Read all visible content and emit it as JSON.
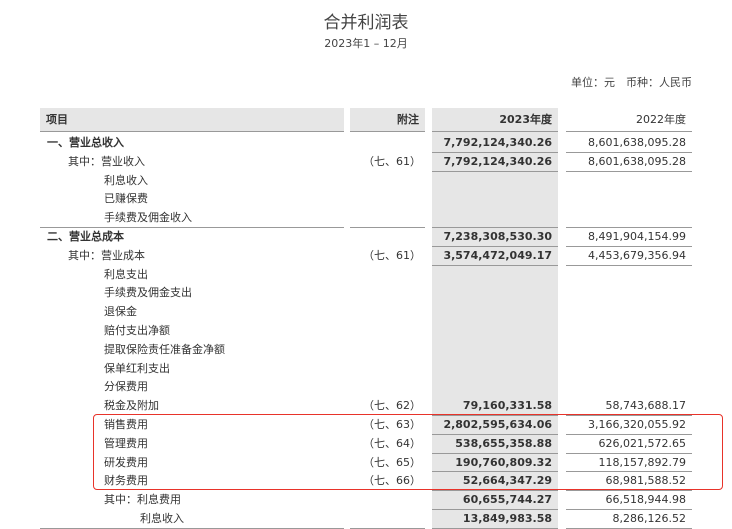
{
  "title": "合并利润表",
  "period": "2023年1 – 12月",
  "unit": "单位：元　币种：人民币",
  "headers": {
    "item": "项目",
    "note": "附注",
    "y2023": "2023年度",
    "y2022": "2022年度"
  },
  "highlight_color": "#e8332a",
  "rows": [
    {
      "label": "一、营业总收入",
      "level": 0,
      "bold": true,
      "note": "",
      "v2023": "7,792,124,340.26",
      "v2022": "8,601,638,095.28"
    },
    {
      "label": "其中：营业收入",
      "level": 1,
      "note": "（七、61）",
      "v2023": "7,792,124,340.26",
      "v2022": "8,601,638,095.28"
    },
    {
      "label": "利息收入",
      "level": 2,
      "note": "",
      "v2023": "",
      "v2022": ""
    },
    {
      "label": "已赚保费",
      "level": 2,
      "note": "",
      "v2023": "",
      "v2022": ""
    },
    {
      "label": "手续费及佣金收入",
      "level": 2,
      "note": "",
      "v2023": "",
      "v2022": "",
      "section_end": true
    },
    {
      "label": "二、营业总成本",
      "level": 0,
      "bold": true,
      "note": "",
      "v2023": "7,238,308,530.30",
      "v2022": "8,491,904,154.99"
    },
    {
      "label": "其中：营业成本",
      "level": 1,
      "note": "（七、61）",
      "v2023": "3,574,472,049.17",
      "v2022": "4,453,679,356.94"
    },
    {
      "label": "利息支出",
      "level": 2,
      "note": "",
      "v2023": "",
      "v2022": ""
    },
    {
      "label": "手续费及佣金支出",
      "level": 2,
      "note": "",
      "v2023": "",
      "v2022": ""
    },
    {
      "label": "退保金",
      "level": 2,
      "note": "",
      "v2023": "",
      "v2022": ""
    },
    {
      "label": "赔付支出净额",
      "level": 2,
      "note": "",
      "v2023": "",
      "v2022": ""
    },
    {
      "label": "提取保险责任准备金净额",
      "level": 2,
      "note": "",
      "v2023": "",
      "v2022": ""
    },
    {
      "label": "保单红利支出",
      "level": 2,
      "note": "",
      "v2023": "",
      "v2022": ""
    },
    {
      "label": "分保费用",
      "level": 2,
      "note": "",
      "v2023": "",
      "v2022": ""
    },
    {
      "label": "税金及附加",
      "level": 2,
      "note": "（七、62）",
      "v2023": "79,160,331.58",
      "v2022": "58,743,688.17"
    },
    {
      "label": "销售费用",
      "level": 2,
      "note": "（七、63）",
      "v2023": "2,802,595,634.06",
      "v2022": "3,166,320,055.92"
    },
    {
      "label": "管理费用",
      "level": 2,
      "note": "（七、64）",
      "v2023": "538,655,358.88",
      "v2022": "626,021,572.65"
    },
    {
      "label": "研发费用",
      "level": 2,
      "note": "（七、65）",
      "v2023": "190,760,809.32",
      "v2022": "118,157,892.79"
    },
    {
      "label": "财务费用",
      "level": 2,
      "note": "（七、66）",
      "v2023": "52,664,347.29",
      "v2022": "68,981,588.52"
    },
    {
      "label": "其中：利息费用",
      "level": 2,
      "note": "",
      "v2023": "60,655,744.27",
      "v2022": "66,518,944.98"
    },
    {
      "label": "利息收入",
      "level": 3,
      "note": "",
      "v2023": "13,849,983.58",
      "v2022": "8,286,126.52",
      "section_end": true
    }
  ]
}
